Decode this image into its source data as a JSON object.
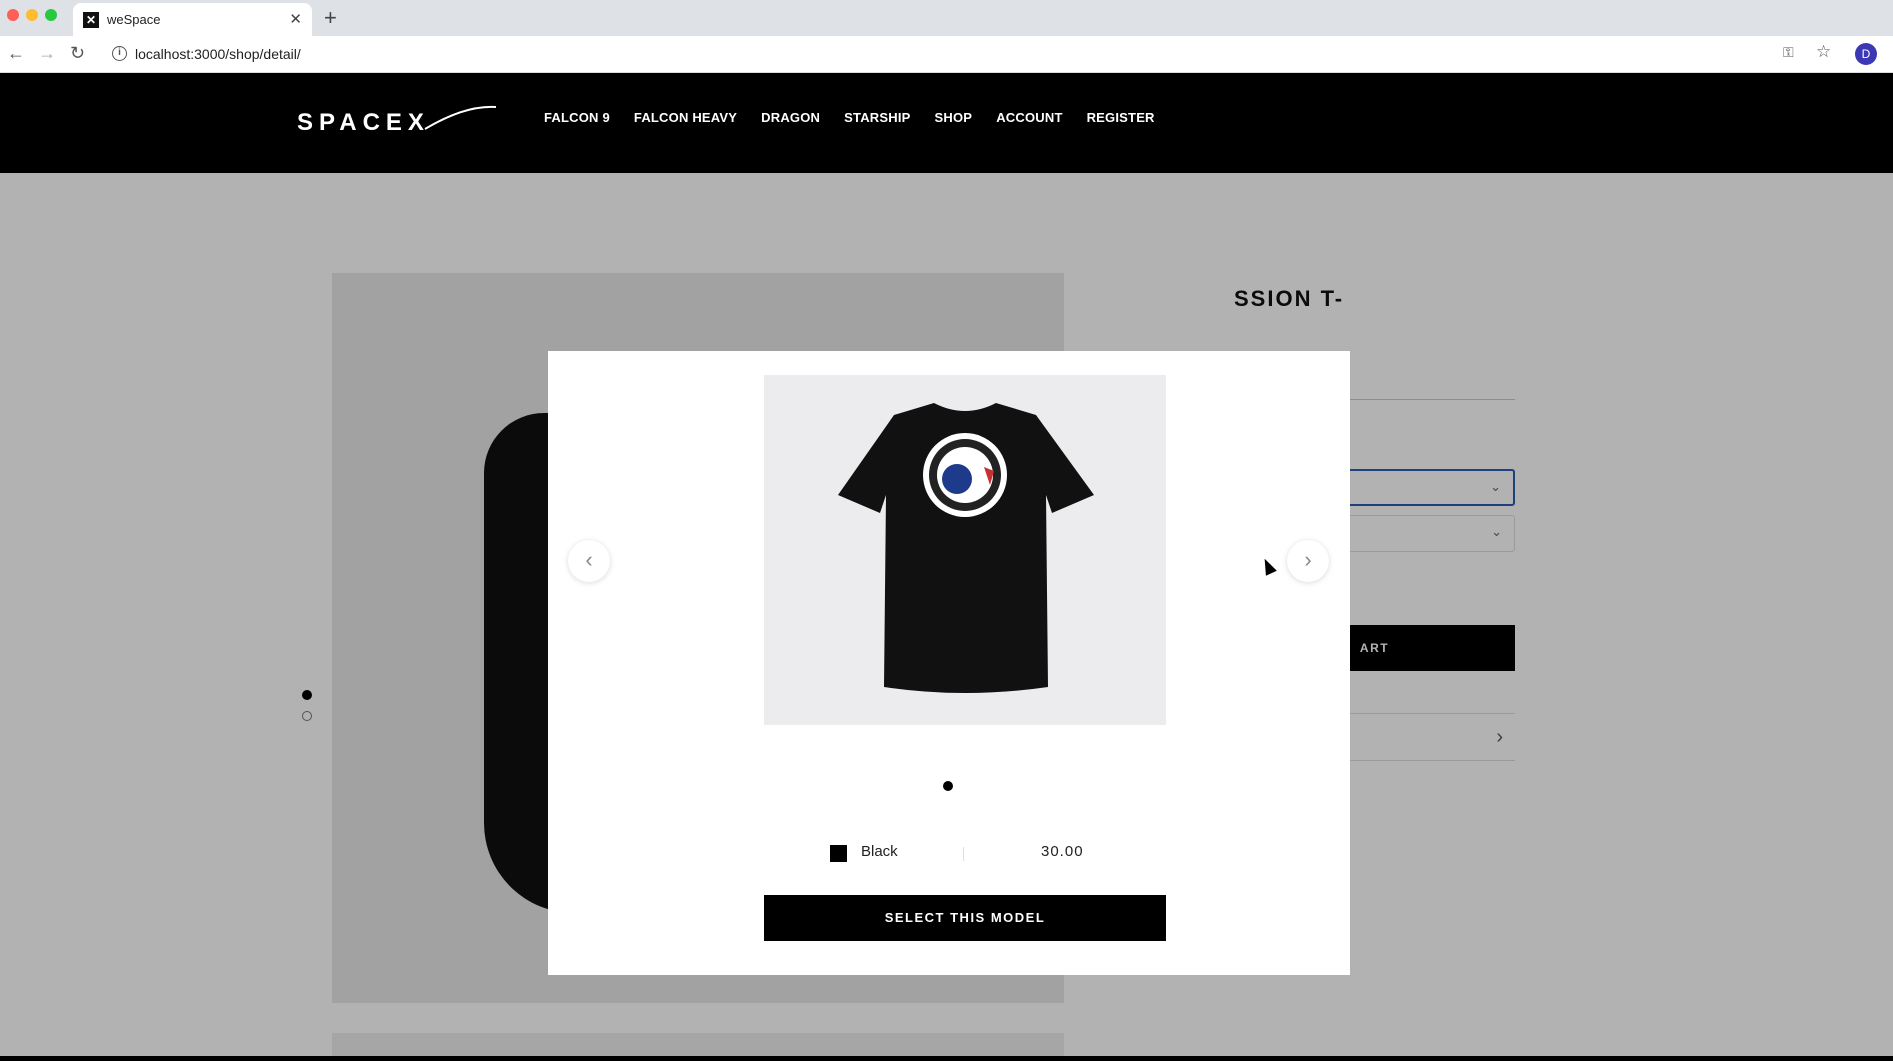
{
  "browser": {
    "tab_title": "weSpace",
    "url": "localhost:3000/shop/detail/",
    "profile_initial": "D"
  },
  "site": {
    "logo_text": "SPACEX",
    "nav": [
      "FALCON 9",
      "FALCON HEAVY",
      "DRAGON",
      "STARSHIP",
      "SHOP",
      "ACCOUNT",
      "REGISTER"
    ]
  },
  "product": {
    "title_visible": "SSION T-",
    "add_to_cart_visible": "ART"
  },
  "modal": {
    "variant_color": "Black",
    "variant_color_hex": "#000000",
    "price": "30.00",
    "select_button": "SELECT THIS MODEL",
    "image_count": 1,
    "active_image": 1
  },
  "gallery": {
    "image_count": 2,
    "active_image": 1
  }
}
